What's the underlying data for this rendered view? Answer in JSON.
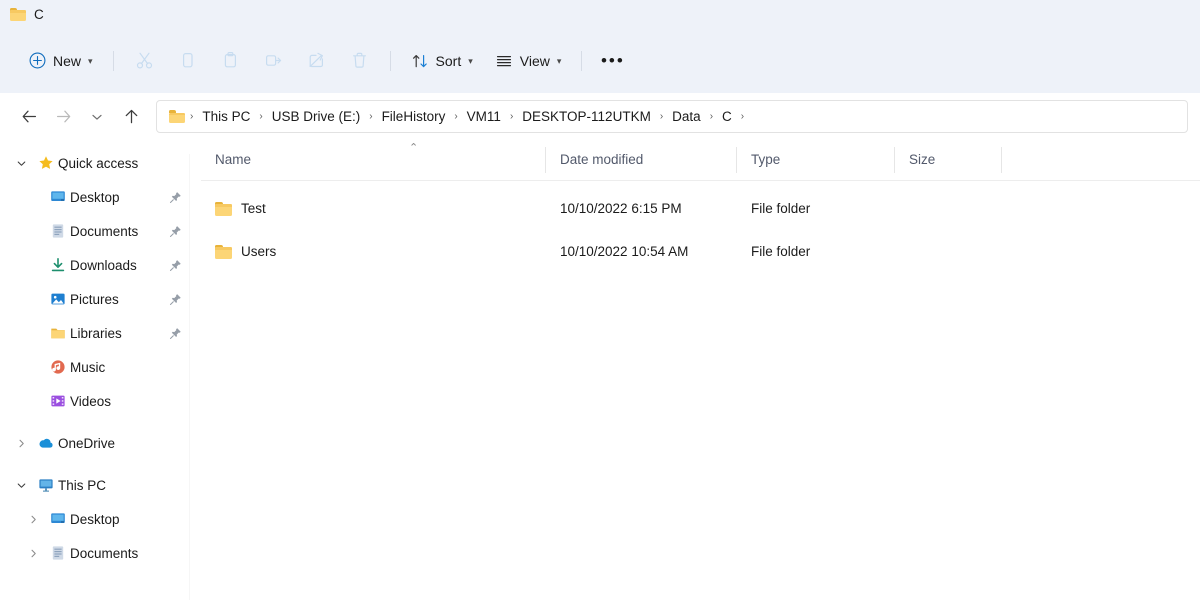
{
  "window": {
    "title": "C",
    "folder_icon": "folder-icon"
  },
  "toolbar": {
    "new_label": "New",
    "cut_label": "Cut",
    "copy_label": "Copy",
    "paste_label": "Paste",
    "rename_label": "Rename",
    "share_label": "Share",
    "delete_label": "Delete",
    "sort_label": "Sort",
    "view_label": "View",
    "more_label": "See more",
    "accent_color": "#0f6cbd",
    "disabled_color": "#c7dcf0"
  },
  "navigation": {
    "back_label": "Back",
    "forward_label": "Forward",
    "recent_label": "Recent locations",
    "up_label": "Up to Data",
    "breadcrumb": [
      "This PC",
      "USB Drive (E:)",
      "FileHistory",
      "VM11",
      "DESKTOP-112UTKM",
      "Data",
      "C"
    ],
    "separator": "›"
  },
  "sidebar": {
    "items": [
      {
        "label": "Quick access",
        "icon": "star-icon",
        "expander": "⌄",
        "expanded": true,
        "indent": 0,
        "pinned": false
      },
      {
        "label": "Desktop",
        "icon": "desktop-icon",
        "expander": "",
        "expanded": false,
        "indent": 1,
        "pinned": true
      },
      {
        "label": "Documents",
        "icon": "documents-icon",
        "expander": "",
        "expanded": false,
        "indent": 1,
        "pinned": true
      },
      {
        "label": "Downloads",
        "icon": "downloads-icon",
        "expander": "",
        "expanded": false,
        "indent": 1,
        "pinned": true
      },
      {
        "label": "Pictures",
        "icon": "pictures-icon",
        "expander": "",
        "expanded": false,
        "indent": 1,
        "pinned": true
      },
      {
        "label": "Libraries",
        "icon": "folder-icon",
        "expander": "",
        "expanded": false,
        "indent": 1,
        "pinned": true
      },
      {
        "label": "Music",
        "icon": "music-icon",
        "expander": "",
        "expanded": false,
        "indent": 1,
        "pinned": false
      },
      {
        "label": "Videos",
        "icon": "videos-icon",
        "expander": "",
        "expanded": false,
        "indent": 1,
        "pinned": false
      },
      {
        "label": "",
        "icon": "spacer",
        "expander": "",
        "expanded": false,
        "indent": 0,
        "pinned": false
      },
      {
        "label": "OneDrive",
        "icon": "onedrive-icon",
        "expander": "›",
        "expanded": false,
        "indent": 0,
        "pinned": false
      },
      {
        "label": "",
        "icon": "spacer",
        "expander": "",
        "expanded": false,
        "indent": 0,
        "pinned": false
      },
      {
        "label": "This PC",
        "icon": "pc-icon",
        "expander": "⌄",
        "expanded": true,
        "indent": 0,
        "pinned": false
      },
      {
        "label": "Desktop",
        "icon": "desktop-icon",
        "expander": "›",
        "expanded": false,
        "indent": 1,
        "pinned": false
      },
      {
        "label": "Documents",
        "icon": "documents-icon",
        "expander": "›",
        "expanded": false,
        "indent": 1,
        "pinned": false
      }
    ]
  },
  "filelist": {
    "columns": [
      {
        "key": "name",
        "label": "Name",
        "sorted": true,
        "sort_dir": "ascending"
      },
      {
        "key": "date",
        "label": "Date modified",
        "sorted": false,
        "sort_dir": ""
      },
      {
        "key": "type",
        "label": "Type",
        "sorted": false,
        "sort_dir": ""
      },
      {
        "key": "size",
        "label": "Size",
        "sorted": false,
        "sort_dir": ""
      }
    ],
    "sort_ascending_glyph": "⌃",
    "rows": [
      {
        "name": "Test",
        "date": "10/10/2022 6:15 PM",
        "type": "File folder",
        "size": "",
        "icon": "folder-icon"
      },
      {
        "name": "Users",
        "date": "10/10/2022 10:54 AM",
        "type": "File folder",
        "size": "",
        "icon": "folder-icon"
      }
    ]
  }
}
